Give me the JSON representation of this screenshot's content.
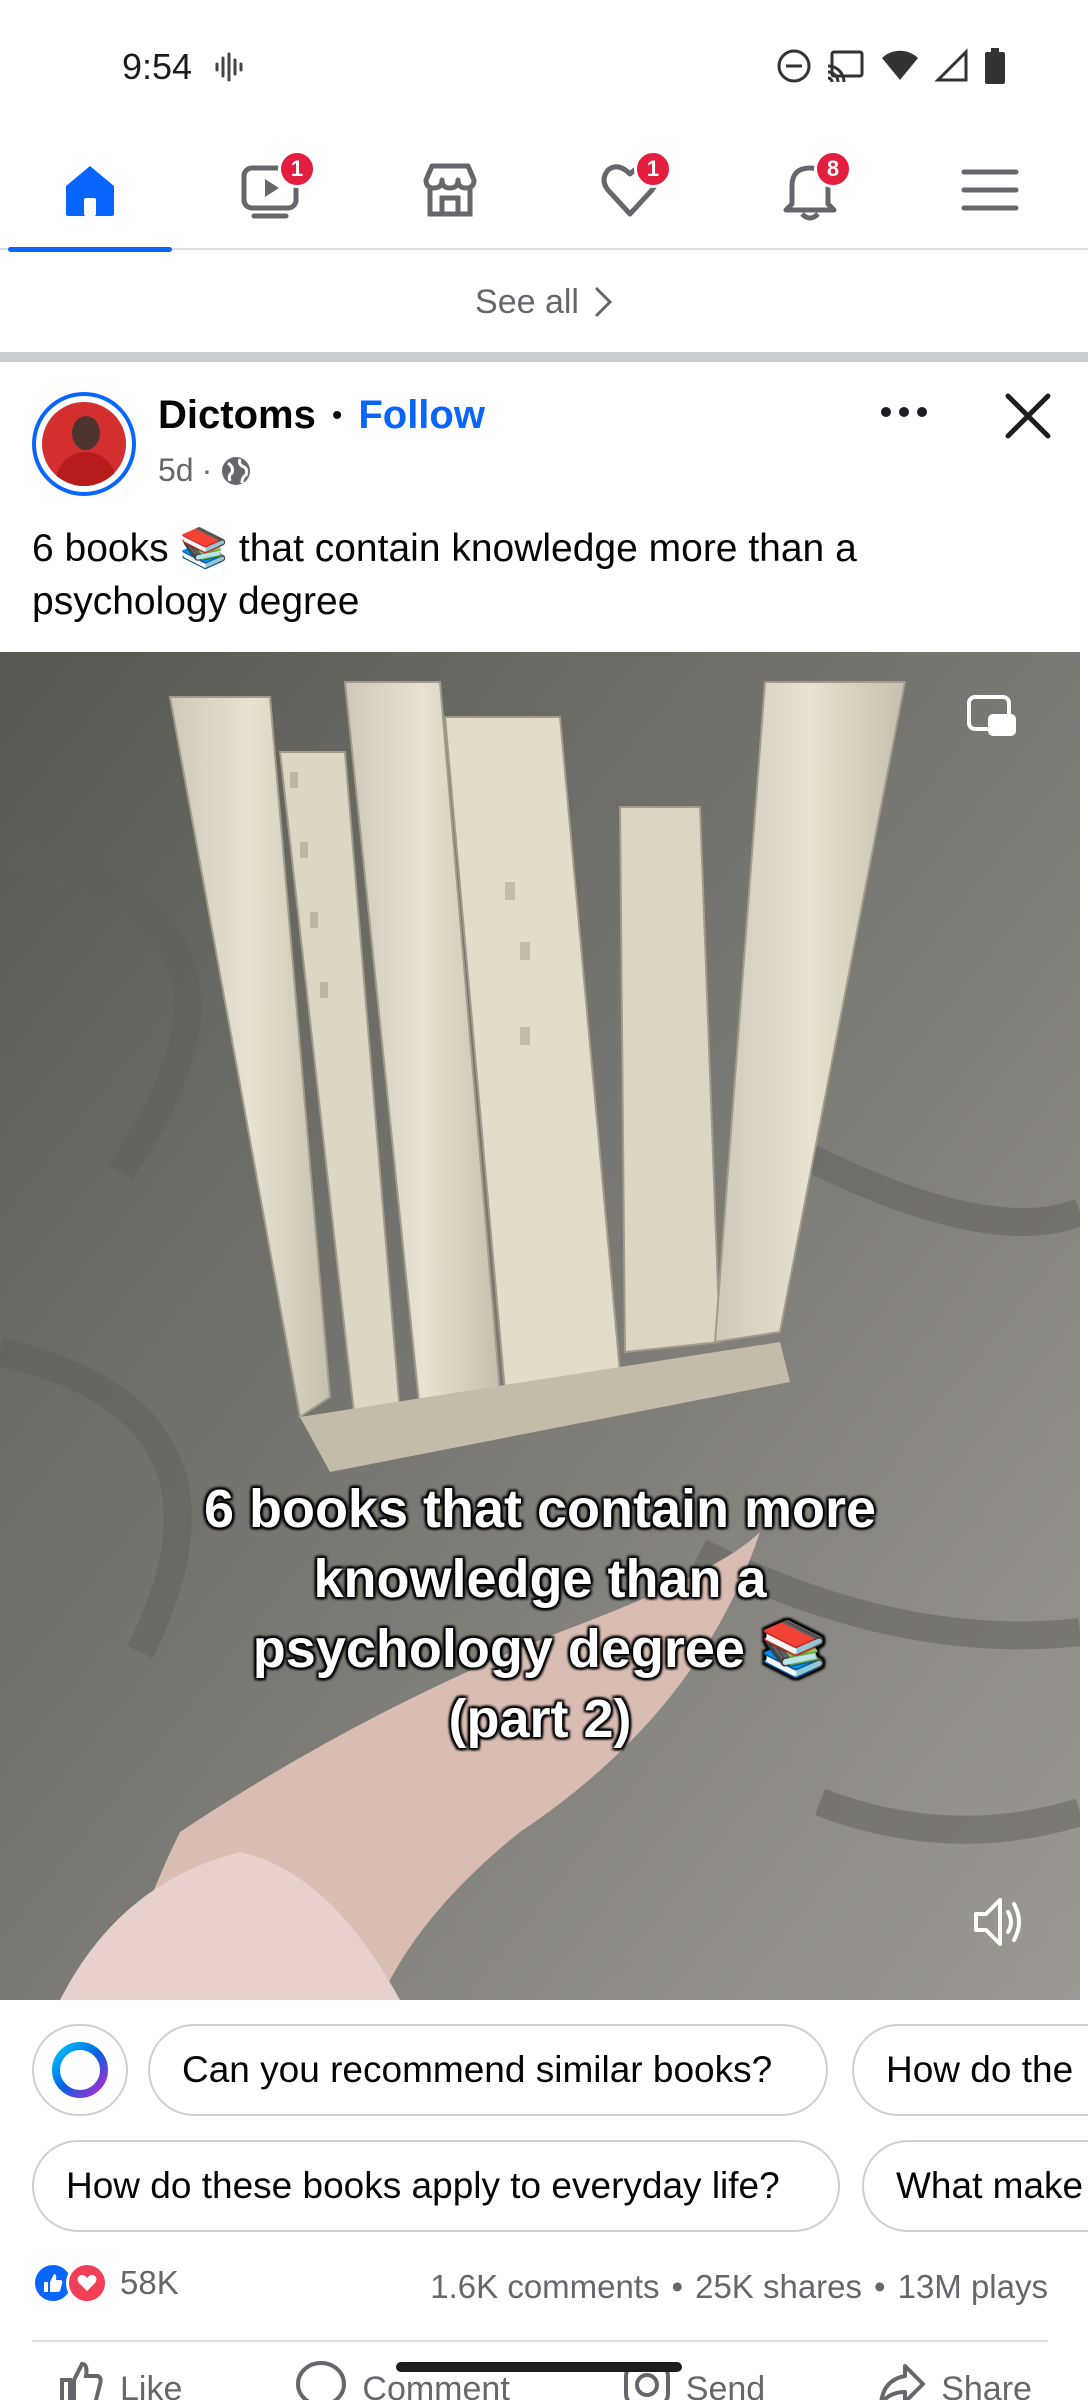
{
  "status_bar": {
    "time": "9:54",
    "icons": [
      "voice-waveform-icon",
      "do-not-disturb-icon",
      "cast-icon",
      "wifi-icon",
      "cell-signal-icon",
      "battery-icon"
    ]
  },
  "nav": {
    "tabs": [
      {
        "name": "home",
        "icon": "home-icon",
        "active": true,
        "badge": ""
      },
      {
        "name": "video",
        "icon": "video-icon",
        "active": false,
        "badge": "1"
      },
      {
        "name": "marketplace",
        "icon": "marketplace-icon",
        "active": false,
        "badge": ""
      },
      {
        "name": "dating",
        "icon": "heart-icon",
        "active": false,
        "badge": "1"
      },
      {
        "name": "notifications",
        "icon": "bell-icon",
        "active": false,
        "badge": "8"
      },
      {
        "name": "menu",
        "icon": "menu-icon",
        "active": false,
        "badge": ""
      }
    ],
    "accent": "#0866ff"
  },
  "see_all": {
    "label": "See all"
  },
  "post": {
    "author": "Dictoms",
    "separator": "•",
    "follow_label": "Follow",
    "time": "5d",
    "meta_sep": "·",
    "audience_icon": "globe-icon",
    "caption_before": "6 books",
    "caption_emoji": "📚",
    "caption_after": "that contain knowledge more than a psychology degree",
    "video": {
      "overlay_lines": [
        "6 books that contain more",
        "knowledge than a",
        "psychology degree 📚",
        "(part 2)"
      ]
    }
  },
  "suggestions": {
    "row1": [
      "Can you recommend similar books?",
      "How do the"
    ],
    "row2": [
      "How do these books apply to everyday life?",
      "What make"
    ]
  },
  "engagement": {
    "reaction_count": "58K",
    "comments": "1.6K comments",
    "shares": "25K shares",
    "plays": "13M plays",
    "dot": "•"
  },
  "actions": {
    "like": "Like",
    "comment": "Comment",
    "send": "Send",
    "share": "Share"
  }
}
